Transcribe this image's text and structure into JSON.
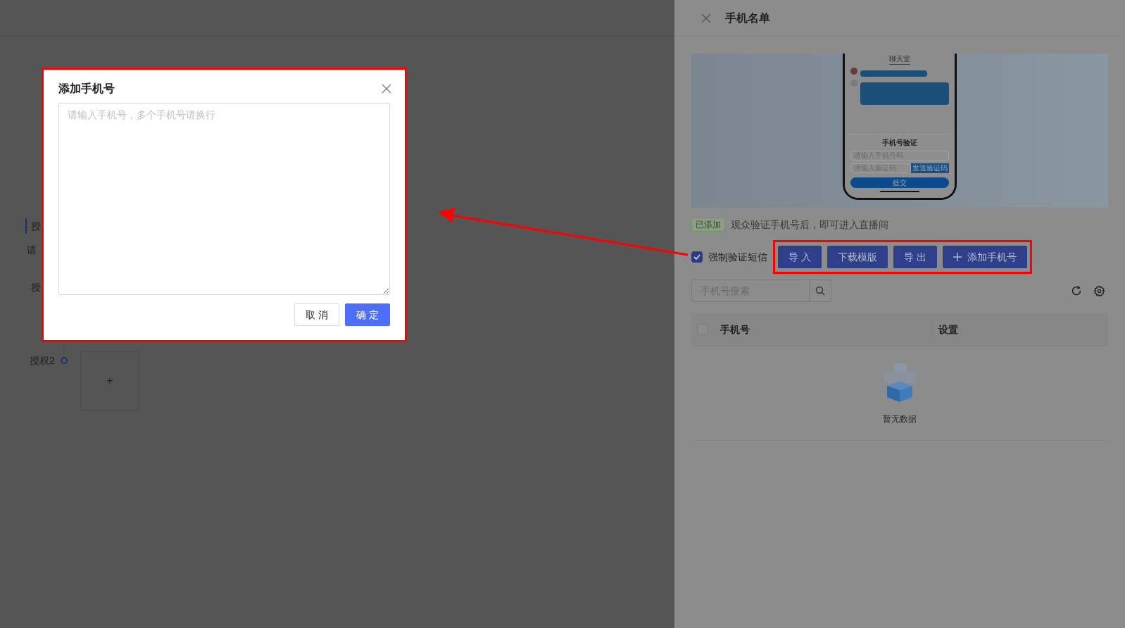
{
  "background_page": {
    "section_title": "授",
    "hint": "请",
    "field_label": "授",
    "step_label": "授权2",
    "upload_button": "+"
  },
  "modal": {
    "title": "添加手机号",
    "textarea": {
      "placeholder": "请输入手机号，多个手机号请换行"
    },
    "buttons": [
      {
        "label": "取 消",
        "kind": "default"
      },
      {
        "label": "确 定",
        "kind": "primary"
      }
    ]
  },
  "drawer": {
    "title": "手机名单",
    "preview": {
      "tab": "聊天室",
      "sheet_title": "手机号验证",
      "phone_placeholder": "请输入手机号码",
      "code_placeholder": "请输入验证码",
      "send_code": "发送验证码",
      "submit": "提交"
    },
    "status_tag": "已添加",
    "description": "观众验证手机号后，即可进入直播间",
    "force_sms": {
      "label": "强制验证短信",
      "checked": true
    },
    "actions": [
      {
        "label": "导 入",
        "kind": "plain"
      },
      {
        "label": "下载模版",
        "kind": "plain"
      },
      {
        "label": "导 出",
        "kind": "plain"
      },
      {
        "label": "添加手机号",
        "kind": "add"
      }
    ],
    "search": {
      "placeholder": "手机号搜索"
    },
    "table": {
      "header_checked": false,
      "columns": [
        "手机号",
        "设置"
      ],
      "empty_text": "暂无数据"
    }
  }
}
